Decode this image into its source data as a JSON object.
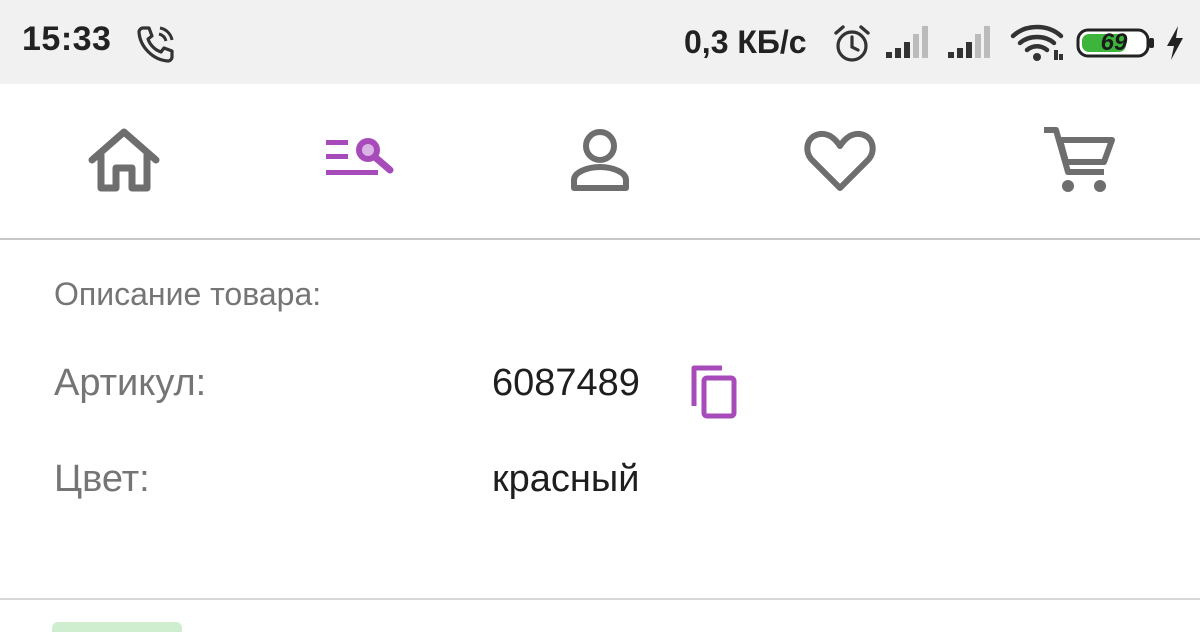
{
  "status_bar": {
    "time": "15:33",
    "speed": "0,3 КБ/с",
    "battery": "69",
    "icons": [
      "call-icon",
      "alarm-icon",
      "signal-icon",
      "signal-icon",
      "wifi-icon",
      "battery-icon",
      "charging-icon"
    ]
  },
  "tabs": [
    {
      "name": "home",
      "icon": "home-icon"
    },
    {
      "name": "catalog",
      "icon": "catalog-search-icon",
      "active": true
    },
    {
      "name": "profile",
      "icon": "person-icon"
    },
    {
      "name": "favorites",
      "icon": "heart-icon"
    },
    {
      "name": "cart",
      "icon": "cart-icon"
    }
  ],
  "colors": {
    "accent": "#a64bb9",
    "icon_gray": "#6e6e6e",
    "label_gray": "#757575"
  },
  "product": {
    "section_title": "Описание товара:",
    "article_label": "Артикул:",
    "article_value": "6087489",
    "color_label": "Цвет:",
    "color_value": "красный"
  }
}
